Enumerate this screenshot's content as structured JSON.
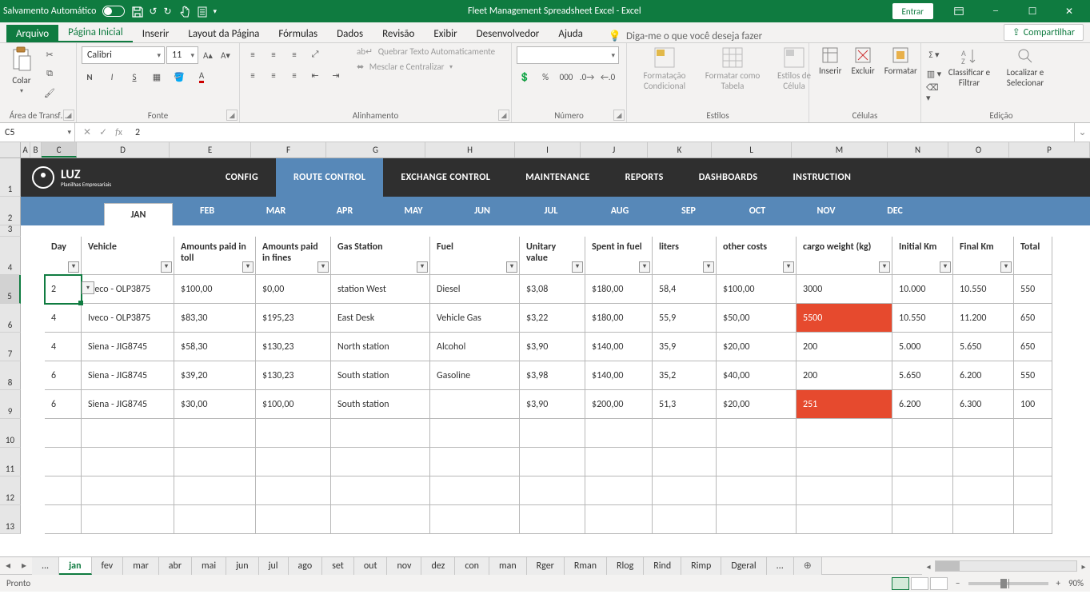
{
  "titlebar": {
    "autosave": "Salvamento Automático",
    "title": "Fleet Management Spreadsheet Excel  -  Excel",
    "signin": "Entrar"
  },
  "ribbon_tabs": {
    "file": "Arquivo",
    "home": "Página Inicial",
    "insert": "Inserir",
    "layout": "Layout da Página",
    "formulas": "Fórmulas",
    "data": "Dados",
    "review": "Revisão",
    "view": "Exibir",
    "developer": "Desenvolvedor",
    "help": "Ajuda",
    "tellme": "Diga-me o que você deseja fazer",
    "share": "Compartilhar"
  },
  "ribbon": {
    "clipboard": {
      "paste": "Colar",
      "group": "Área de Transf…"
    },
    "font": {
      "name": "Calibri",
      "size": "11",
      "group": "Fonte"
    },
    "alignment": {
      "wrap": "Quebrar Texto Automaticamente",
      "merge": "Mesclar e Centralizar",
      "group": "Alinhamento"
    },
    "number": {
      "group": "Número"
    },
    "styles": {
      "cond": "Formatação Condicional",
      "table": "Formatar como Tabela",
      "cell": "Estilos de Célula",
      "group": "Estilos"
    },
    "cells": {
      "insert": "Inserir",
      "delete": "Excluir",
      "format": "Formatar",
      "group": "Células"
    },
    "editing": {
      "sort": "Classificar e Filtrar",
      "find": "Localizar e Selecionar",
      "group": "Edição"
    }
  },
  "formula_bar": {
    "name_box": "C5",
    "formula": "2"
  },
  "columns": [
    "A",
    "B",
    "C",
    "D",
    "E",
    "F",
    "G",
    "H",
    "I",
    "J",
    "K",
    "L",
    "M",
    "N",
    "O",
    "P"
  ],
  "rows_visible": [
    "1",
    "2",
    "3",
    "4",
    "5",
    "6",
    "7",
    "8",
    "9",
    "10",
    "11",
    "12",
    "13"
  ],
  "app_nav": {
    "brand": "LUZ",
    "brand_sub": "Planilhas Empresariais",
    "items": [
      "CONFIG",
      "ROUTE CONTROL",
      "EXCHANGE CONTROL",
      "MAINTENANCE",
      "REPORTS",
      "DASHBOARDS",
      "INSTRUCTION"
    ],
    "active": "ROUTE CONTROL"
  },
  "months": {
    "list": [
      "JAN",
      "FEB",
      "MAR",
      "APR",
      "MAY",
      "JUN",
      "JUL",
      "AUG",
      "SEP",
      "OCT",
      "NOV",
      "DEC"
    ],
    "active": "JAN"
  },
  "table": {
    "headers": {
      "day": "Day",
      "vehicle": "Vehicle",
      "toll": "Amounts paid in toll",
      "fines": "Amounts paid in fines",
      "gas": "Gas Station",
      "fuel": "Fuel",
      "unit": "Unitary value",
      "spent": "Spent in fuel",
      "liters": "liters",
      "other": "other costs",
      "cargo": "cargo weight (kg)",
      "ikm": "Initial Km",
      "fkm": "Final Km",
      "total": "Total"
    },
    "rows": [
      {
        "day": "2",
        "vehicle": "Iveco - OLP3875",
        "toll": "$100,00",
        "fines": "$0,00",
        "gas": "station West",
        "fuel": "Diesel",
        "unit": "$3,08",
        "spent": "$180,00",
        "liters": "58,4",
        "other": "$100,00",
        "cargo": "3000",
        "cargo_red": false,
        "ikm": "10.000",
        "fkm": "10.550",
        "total": "550"
      },
      {
        "day": "4",
        "vehicle": "Iveco - OLP3875",
        "toll": "$83,30",
        "fines": "$195,23",
        "gas": "East Desk",
        "fuel": "Vehicle Gas",
        "unit": "$3,22",
        "spent": "$180,00",
        "liters": "55,9",
        "other": "$50,00",
        "cargo": "5500",
        "cargo_red": true,
        "ikm": "10.550",
        "fkm": "11.200",
        "total": "650"
      },
      {
        "day": "4",
        "vehicle": "Siena - JIG8745",
        "toll": "$58,30",
        "fines": "$130,23",
        "gas": "North station",
        "fuel": "Alcohol",
        "unit": "$3,90",
        "spent": "$140,00",
        "liters": "35,9",
        "other": "$20,00",
        "cargo": "200",
        "cargo_red": false,
        "ikm": "5.000",
        "fkm": "5.650",
        "total": "650"
      },
      {
        "day": "6",
        "vehicle": "Siena - JIG8745",
        "toll": "$39,20",
        "fines": "$130,23",
        "gas": "South station",
        "fuel": "Gasoline",
        "unit": "$3,98",
        "spent": "$140,00",
        "liters": "35,2",
        "other": "$40,00",
        "cargo": "200",
        "cargo_red": false,
        "ikm": "5.650",
        "fkm": "6.200",
        "total": "550"
      },
      {
        "day": "6",
        "vehicle": "Siena - JIG8745",
        "toll": "$30,00",
        "fines": "$100,00",
        "gas": "South station",
        "fuel": "",
        "unit": "$3,90",
        "spent": "$200,00",
        "liters": "51,3",
        "other": "$20,00",
        "cargo": "251",
        "cargo_red": true,
        "ikm": "6.200",
        "fkm": "6.300",
        "total": "100"
      }
    ]
  },
  "sheet_tabs": [
    "...",
    "jan",
    "fev",
    "mar",
    "abr",
    "mai",
    "jun",
    "jul",
    "ago",
    "set",
    "out",
    "nov",
    "dez",
    "con",
    "man",
    "Rger",
    "Rman",
    "Rlog",
    "Rind",
    "Rimp",
    "Dgeral",
    "..."
  ],
  "sheet_tabs_active": "jan",
  "status": {
    "ready": "Pronto",
    "zoom": "90%"
  }
}
